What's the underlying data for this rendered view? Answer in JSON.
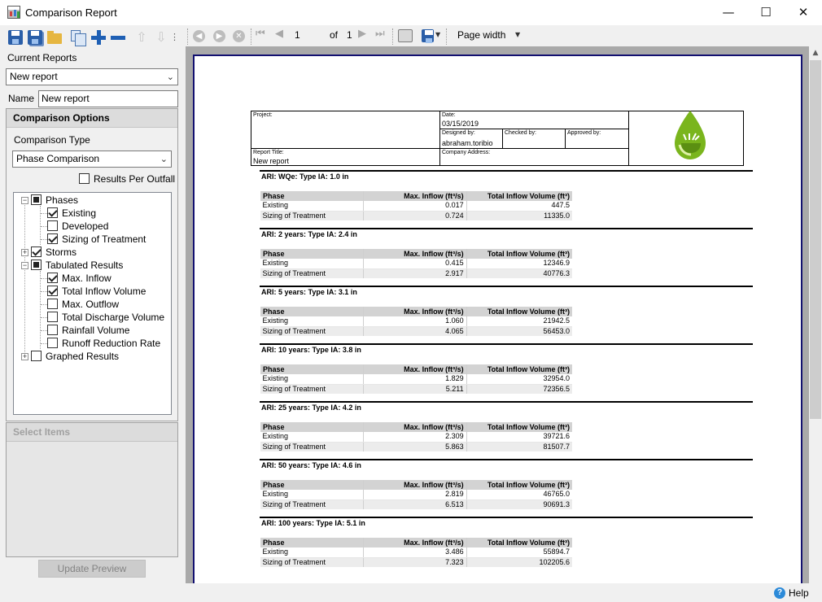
{
  "window": {
    "title": "Comparison Report",
    "minimize": "—",
    "maximize": "☐",
    "close": "✕"
  },
  "left_toolbar": {
    "icons": [
      "save-icon",
      "save-as-icon",
      "open-folder-icon",
      "copy-icon",
      "add-icon",
      "remove-icon",
      "move-up-icon",
      "move-down-icon",
      "more-icon"
    ]
  },
  "current_reports": {
    "label": "Current Reports",
    "selected": "New report",
    "name_label": "Name",
    "name_value": "New report"
  },
  "comparison_options": {
    "header": "Comparison Options",
    "type_label": "Comparison Type",
    "type_selected": "Phase Comparison",
    "results_per_outfall": "Results Per Outfall",
    "results_per_outfall_checked": false,
    "tree": [
      {
        "label": "Phases",
        "state": "partial",
        "expanded": true,
        "level": 0
      },
      {
        "label": "Existing",
        "state": "checked",
        "level": 1
      },
      {
        "label": "Developed",
        "state": "unchecked",
        "level": 1
      },
      {
        "label": "Sizing of Treatment",
        "state": "checked",
        "level": 1
      },
      {
        "label": "Storms",
        "state": "checked",
        "expanded": false,
        "level": 0
      },
      {
        "label": "Tabulated Results",
        "state": "partial",
        "expanded": true,
        "level": 0
      },
      {
        "label": "Max. Inflow",
        "state": "checked",
        "level": 1
      },
      {
        "label": "Total Inflow Volume",
        "state": "checked",
        "level": 1
      },
      {
        "label": "Max. Outflow",
        "state": "unchecked",
        "level": 1
      },
      {
        "label": "Total Discharge Volume",
        "state": "unchecked",
        "level": 1
      },
      {
        "label": "Rainfall Volume",
        "state": "unchecked",
        "level": 1
      },
      {
        "label": "Runoff Reduction Rate",
        "state": "unchecked",
        "level": 1
      },
      {
        "label": "Graphed Results",
        "state": "unchecked",
        "expanded": false,
        "level": 0
      }
    ]
  },
  "select_items": {
    "header": "Select Items"
  },
  "update_button": "Update Preview",
  "preview_toolbar": {
    "page_current": "1",
    "of_label": "of",
    "page_total": "1",
    "zoom": "Page width"
  },
  "report": {
    "project_caption": "Project:",
    "project_value": "",
    "date_caption": "Date:",
    "date_value": "03/15/2019",
    "designed_caption": "Designed by:",
    "designed_value": "abraham.toribio",
    "checked_caption": "Checked by:",
    "approved_caption": "Approved by:",
    "title_caption": "Report Title:",
    "title_value": "New report",
    "company_caption": "Company Address:",
    "columns": [
      "Phase",
      "Max. Inflow (ft³/s)",
      "Total Inflow Volume (ft³)"
    ],
    "sections": [
      {
        "title": "ARI: WQe: Type IA: 1.0 in",
        "rows": [
          [
            "Existing",
            "0.017",
            "447.5"
          ],
          [
            "Sizing of Treatment",
            "0.724",
            "11335.0"
          ]
        ]
      },
      {
        "title": "ARI: 2 years: Type IA: 2.4 in",
        "rows": [
          [
            "Existing",
            "0.415",
            "12346.9"
          ],
          [
            "Sizing of Treatment",
            "2.917",
            "40776.3"
          ]
        ]
      },
      {
        "title": "ARI: 5 years: Type IA: 3.1 in",
        "rows": [
          [
            "Existing",
            "1.060",
            "21942.5"
          ],
          [
            "Sizing of Treatment",
            "4.065",
            "56453.0"
          ]
        ]
      },
      {
        "title": "ARI: 10 years: Type IA: 3.8 in",
        "rows": [
          [
            "Existing",
            "1.829",
            "32954.0"
          ],
          [
            "Sizing of Treatment",
            "5.211",
            "72356.5"
          ]
        ]
      },
      {
        "title": "ARI: 25 years: Type IA: 4.2 in",
        "rows": [
          [
            "Existing",
            "2.309",
            "39721.6"
          ],
          [
            "Sizing of Treatment",
            "5.863",
            "81507.7"
          ]
        ]
      },
      {
        "title": "ARI: 50 years: Type IA: 4.6 in",
        "rows": [
          [
            "Existing",
            "2.819",
            "46765.0"
          ],
          [
            "Sizing of Treatment",
            "6.513",
            "90691.3"
          ]
        ]
      },
      {
        "title": "ARI: 100 years: Type IA: 5.1 in",
        "rows": [
          [
            "Existing",
            "3.486",
            "55894.7"
          ],
          [
            "Sizing of Treatment",
            "7.323",
            "102205.6"
          ]
        ]
      }
    ]
  },
  "status": {
    "help": "Help"
  },
  "colors": {
    "page_border": "#121070",
    "logo_green": "#7ab51d",
    "help_blue": "#2c8ad8"
  }
}
